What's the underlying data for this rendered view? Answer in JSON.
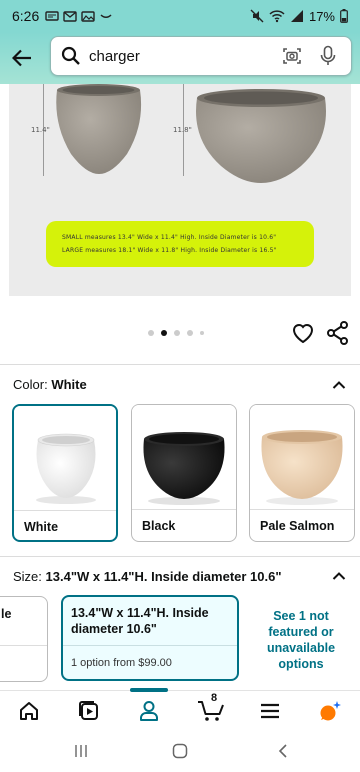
{
  "status_bar": {
    "time": "6:26",
    "battery": "17%"
  },
  "search": {
    "query": "charger"
  },
  "product_image": {
    "small_height_label": "11.4\"",
    "large_height_label": "11.8\"",
    "measure_small": "SMALL measures 13.4\" Wide x 11.4\" High. Inside Diameter is 10.6\"",
    "measure_large": "LARGE measures 18.1\" Wide x 11.8\" High. Inside Diameter is 16.5\"",
    "pot_color": "#9c968c"
  },
  "carousel": {
    "total": 5,
    "active_index": 1
  },
  "color_section": {
    "label": "Color:",
    "value": "White",
    "options": [
      {
        "name": "White",
        "color": "#f6f6f6",
        "selected": true
      },
      {
        "name": "Black",
        "color": "#1b1b1b",
        "selected": false
      },
      {
        "name": "Pale Salmon",
        "color": "#ecd2b4",
        "selected": false
      }
    ]
  },
  "size_section": {
    "label": "Size:",
    "value": "13.4\"W x 11.4\"H. Inside diameter 10.6\"",
    "left_partial": "le",
    "selected_title": "13.4\"W x 11.4\"H. Inside diameter 10.6\"",
    "selected_option": "1 option from $99.00",
    "see_more": "See 1 not featured or unavailable options"
  },
  "bottom_nav": {
    "cart_count": "8",
    "accent": "#007185"
  },
  "colors": {
    "header": "#84d8d1",
    "accent": "#007185",
    "green_box": "#d5f20a"
  }
}
